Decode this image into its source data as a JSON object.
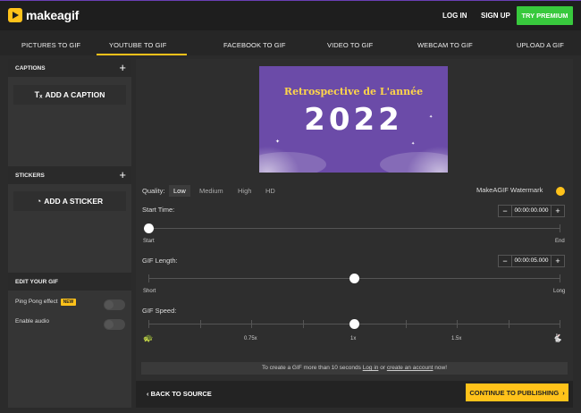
{
  "header": {
    "logo_text": "makeagif",
    "login": "LOG IN",
    "signup": "SIGN UP",
    "try_premium": "TRY PREMIUM"
  },
  "tabs": [
    {
      "label": "PICTURES TO GIF"
    },
    {
      "label": "YOUTUBE TO GIF"
    },
    {
      "label": "FACEBOOK TO GIF"
    },
    {
      "label": "VIDEO TO GIF"
    },
    {
      "label": "WEBCAM TO GIF"
    },
    {
      "label": "UPLOAD A GIF"
    }
  ],
  "sidebar": {
    "captions_title": "CAPTIONS",
    "add_caption": "ADD A CAPTION",
    "stickers_title": "STICKERS",
    "add_sticker": "ADD A STICKER",
    "edit_title": "EDIT YOUR GIF",
    "ping_pong": "Ping Pong effect",
    "new_badge": "NEW",
    "enable_audio": "Enable audio"
  },
  "preview": {
    "line1": "Retrospective de L'année",
    "line2": "2022"
  },
  "quality": {
    "label": "Quality:",
    "options": [
      "Low",
      "Medium",
      "High",
      "HD"
    ],
    "watermark": "MakeAGIF Watermark"
  },
  "start_time": {
    "label": "Start Time:",
    "value": "00:00:00.000",
    "min_label": "Start",
    "max_label": "End",
    "position": 0
  },
  "gif_length": {
    "label": "GIF Length:",
    "value": "00:00:05.000",
    "min_label": "Short",
    "max_label": "Long",
    "position": 0.5
  },
  "gif_speed": {
    "label": "GIF Speed:",
    "ticks": [
      "0.75x",
      "1x",
      "1.5x"
    ],
    "position": 0.5
  },
  "notice": {
    "before": "To create a GIF more than 10 seconds ",
    "login": "Log in",
    "or": " or ",
    "create": "create an account",
    "after": " now!"
  },
  "footer": {
    "back": "BACK TO SOURCE",
    "continue": "CONTINUE TO PUBLISHING"
  },
  "colors": {
    "accent": "#ffc21a",
    "premium": "#38c93d",
    "preview_bg": "#6b4ba8"
  }
}
